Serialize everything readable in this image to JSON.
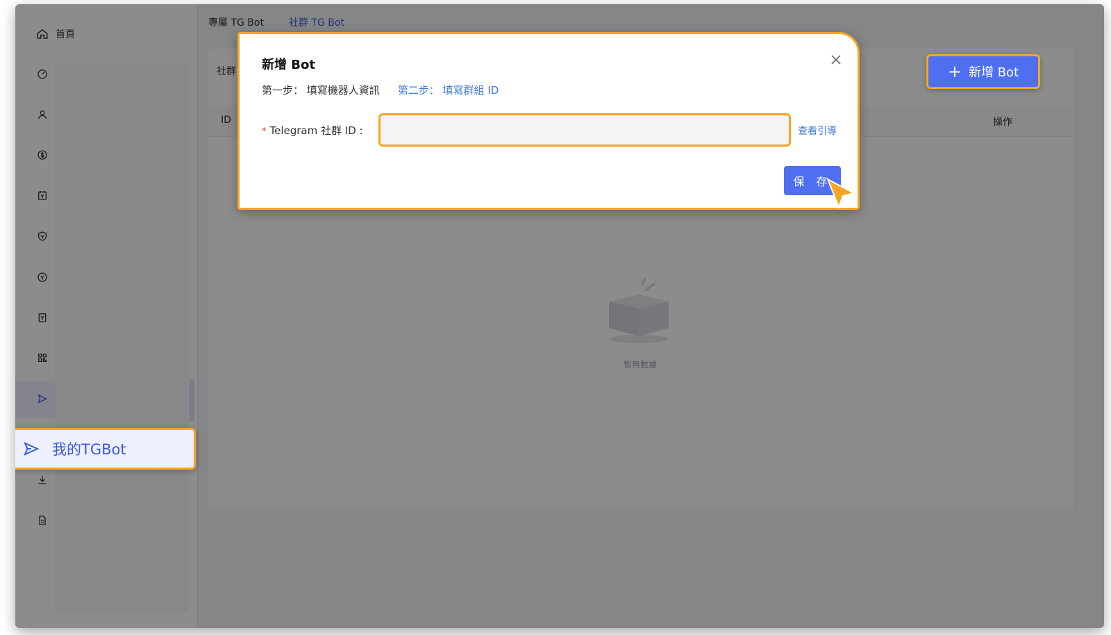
{
  "sidebar": {
    "home_label": "首頁",
    "icons": [
      "dashboard-icon",
      "user-icon",
      "dollar-icon",
      "calendar-icon",
      "shield-icon",
      "coin-icon",
      "voucher-icon",
      "qrcode-icon",
      "send-icon",
      "download-icon",
      "document-icon"
    ],
    "tgbot_label": "我的TGBot"
  },
  "tabs": [
    {
      "label": "專屬 TG Bot",
      "active": false
    },
    {
      "label": "社群 TG Bot",
      "active": true
    }
  ],
  "card": {
    "title": "社群",
    "columns": {
      "id": "ID",
      "truncated": "D",
      "operation": "操作"
    },
    "empty_text": "暫無數據"
  },
  "add_bot_button": {
    "label": "新增 Bot"
  },
  "modal": {
    "title": "新增 Bot",
    "step1": "第一步： 填寫機器人資訊",
    "step2": "第二步： 填寫群組 ID",
    "field_label": "Telegram 社群 ID :",
    "field_value": "",
    "guide_link": "查看引導",
    "save_label": "保 存"
  },
  "colors": {
    "accent": "#4f6ff0",
    "highlight": "#f5a623",
    "link": "#3b7bd6"
  }
}
